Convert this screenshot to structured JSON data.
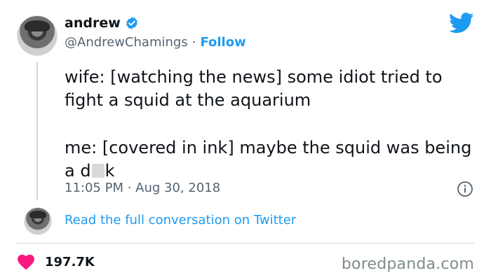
{
  "author": {
    "display_name": "andrew",
    "handle": "@AndrewChamings",
    "separator": "·",
    "follow_label": "Follow"
  },
  "tweet": {
    "line1": "wife: [watching the news] some idiot tried to fight a squid at the aquarium",
    "line2_prefix": "me: [covered in ink] maybe the squid was being a d",
    "line2_suffix": "k",
    "timestamp": "11:05 PM · Aug 30, 2018"
  },
  "conversation": {
    "link_label": "Read the full conversation on Twitter"
  },
  "engagement": {
    "likes": "197.7K"
  },
  "watermark": "boredpanda.com",
  "colors": {
    "accent": "#1d9bf0",
    "heart": "#f91880",
    "secondary_text": "#536471"
  },
  "icons": [
    "verified-badge-icon",
    "twitter-bird-icon",
    "info-icon",
    "heart-icon"
  ]
}
